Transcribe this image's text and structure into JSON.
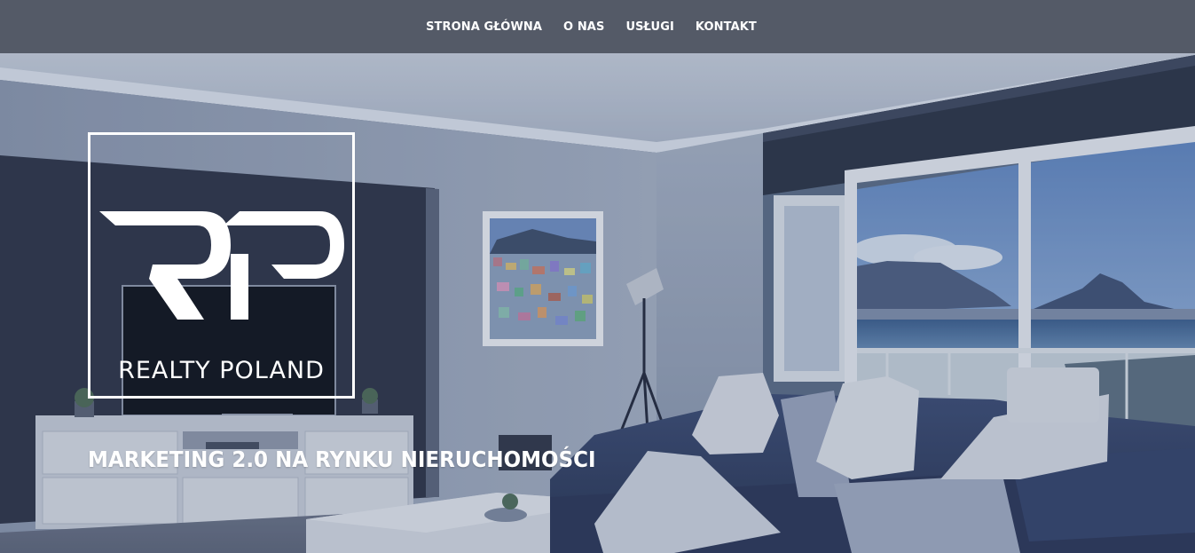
{
  "nav": {
    "items": [
      {
        "label": "STRONA GŁÓWNA"
      },
      {
        "label": "O NAS"
      },
      {
        "label": "USŁUGI"
      },
      {
        "label": "KONTAKT"
      }
    ]
  },
  "logo": {
    "monogram": "RP",
    "name": "REALTY POLAND"
  },
  "hero": {
    "tagline": "MARKETING 2.0 NA RYNKU NIERUCHOMOŚCI",
    "image": "living-room-with-sea-view"
  },
  "colors": {
    "navbar": "#545a67",
    "text": "#ffffff",
    "overlay": "#3a4a6a"
  }
}
